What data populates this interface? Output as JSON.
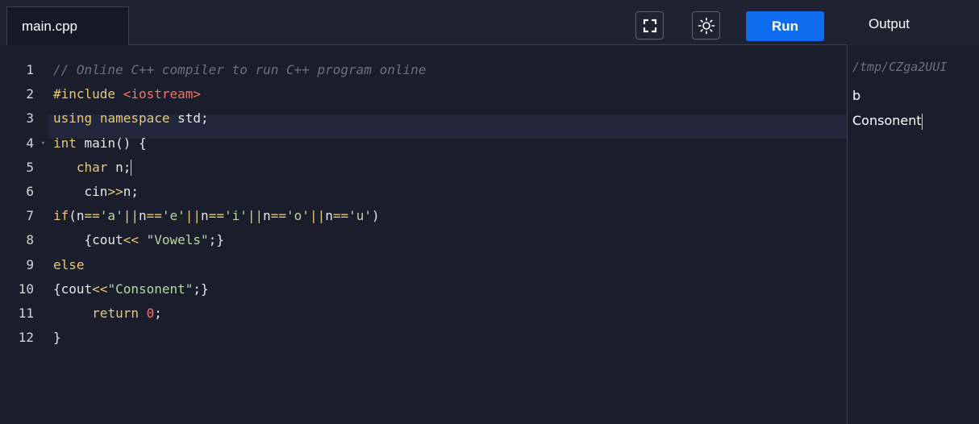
{
  "header": {
    "file_tab": "main.cpp",
    "run_label": "Run",
    "output_label": "Output",
    "icons": {
      "fullscreen": "fullscreen-icon",
      "theme": "sun-icon"
    }
  },
  "colors": {
    "run_button": "#0f6cf0",
    "background": "#1a1d2b",
    "keyword": "#e8c872",
    "string": "#b6d7a8",
    "comment": "#6b6f84",
    "number": "#ff6f61"
  },
  "editor": {
    "line_numbers": [
      "1",
      "2",
      "3",
      "4",
      "5",
      "6",
      "7",
      "8",
      "9",
      "10",
      "11",
      "12"
    ],
    "lines": [
      "// Online C++ compiler to run C++ program online",
      "#include <iostream>",
      "using namespace std;",
      "int main() {",
      "   char n;",
      "    cin>>n;",
      "if(n=='a'||n=='e'||n=='i'||n=='o'||n=='u')",
      "    {cout<< \"Vowels\";}",
      "else",
      "{cout<<\"Consonent\";}",
      "     return 0;",
      "}"
    ]
  },
  "output": {
    "path": "/tmp/CZga2UUI",
    "lines": [
      "b",
      "Consonent"
    ]
  }
}
